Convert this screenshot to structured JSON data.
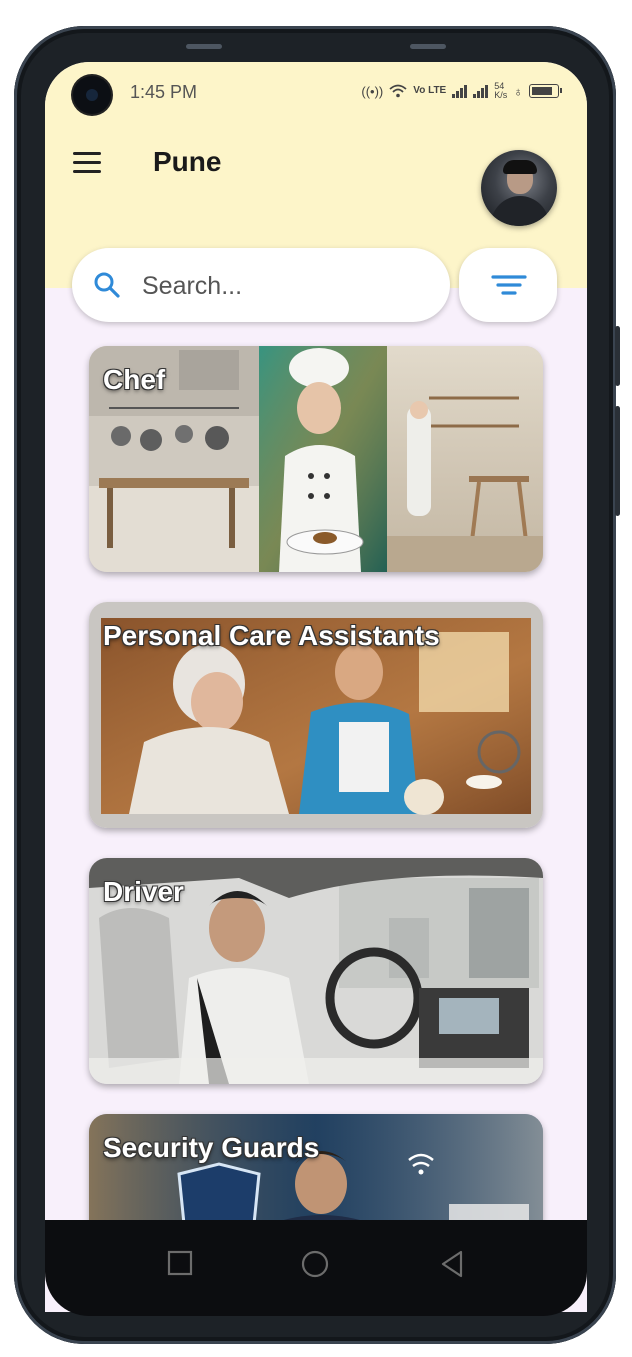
{
  "status_bar": {
    "time": "1:45 PM",
    "network_label": "Vo LTE",
    "speed_value": "54",
    "speed_unit": "K/s"
  },
  "header": {
    "title": "Pune",
    "menu_icon": "hamburger-menu-icon",
    "avatar": "profile-avatar"
  },
  "search": {
    "placeholder": "Search...",
    "icon": "search-icon",
    "filter_icon": "filter-icon"
  },
  "categories": [
    {
      "label": "Chef",
      "image": "chef-kitchen-image"
    },
    {
      "label": "Personal Care Assistants",
      "image": "caregiver-elderly-image"
    },
    {
      "label": "Driver",
      "image": "driver-car-image"
    },
    {
      "label": "Security Guards",
      "image": "security-guard-image"
    }
  ],
  "nav": {
    "recents_icon": "square-recents-icon",
    "home_icon": "circle-home-icon",
    "back_icon": "triangle-back-icon"
  },
  "colors": {
    "header_bg": "#fdf5c9",
    "content_bg": "#f8f0fb",
    "accent_blue": "#2f8ad8"
  }
}
